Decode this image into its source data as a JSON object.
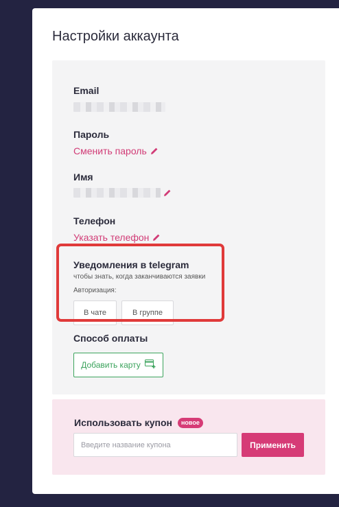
{
  "page": {
    "title": "Настройки аккаунта"
  },
  "email": {
    "label": "Email"
  },
  "password": {
    "label": "Пароль",
    "change_link": "Сменить пароль"
  },
  "name": {
    "label": "Имя"
  },
  "phone": {
    "label": "Телефон",
    "set_link": "Указать телефон"
  },
  "telegram": {
    "title": "Уведомления в telegram",
    "subtitle": "чтобы знать, когда заканчиваются заявки",
    "auth_label": "Авторизация:",
    "chat_button": "В чате",
    "group_button": "В группе"
  },
  "payment": {
    "label": "Способ оплаты",
    "add_card_button": "Добавить карту",
    "icon": "credit-card-plus-icon"
  },
  "coupon": {
    "title": "Использовать купон",
    "badge": "новое",
    "placeholder": "Введите название купона",
    "apply_button": "Применить"
  },
  "colors": {
    "accent": "#d63b76",
    "success": "#3ba35c",
    "highlight": "#e03a3a",
    "background": "#232341"
  }
}
